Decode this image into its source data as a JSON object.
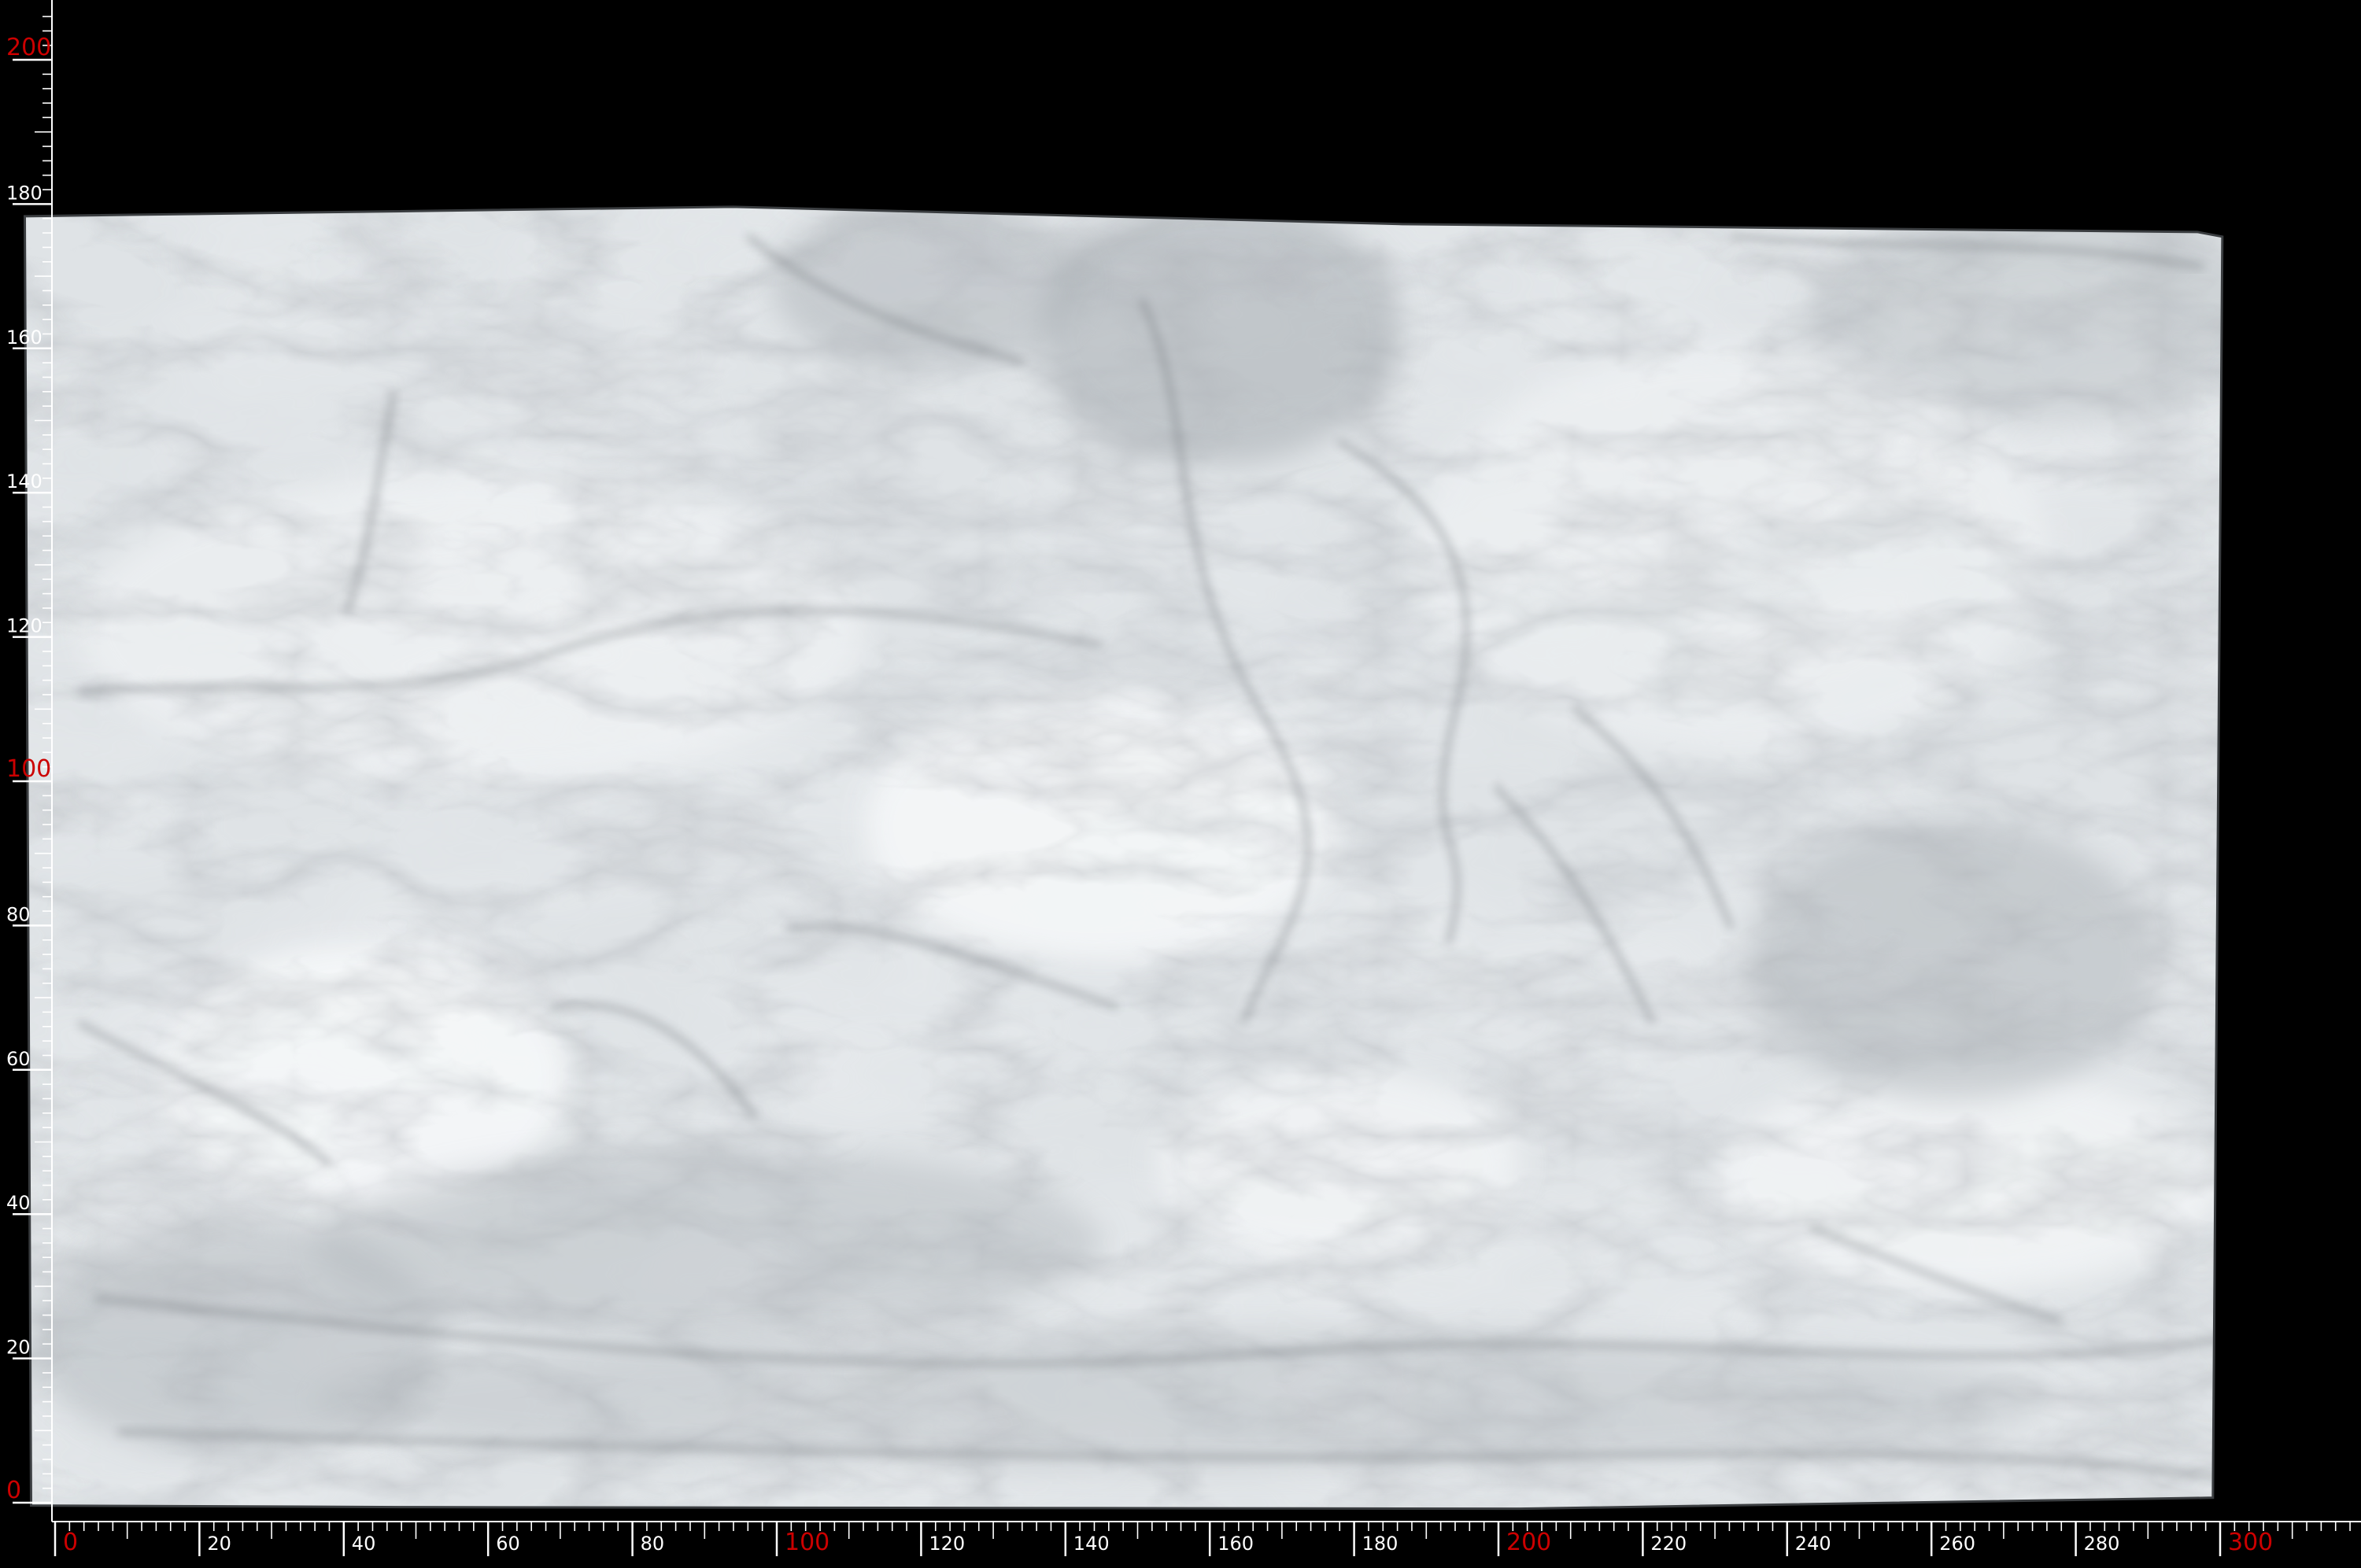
{
  "colors": {
    "background": "#000000",
    "ruler_line": "#ffffff",
    "label_normal": "#ffffff",
    "label_major": "#cc0000",
    "slab_base": "#dfe3e6",
    "slab_vein_dark": "#6f7479",
    "slab_vein_mid": "#a8aeb3",
    "slab_highlight": "#f6f8f9"
  },
  "rulers": {
    "unit_step_minor": 2,
    "unit_step_label": 20,
    "x_axis": {
      "min": 0,
      "max": 320,
      "labels": [
        {
          "value": 0,
          "text": "0",
          "major": true
        },
        {
          "value": 20,
          "text": "20",
          "major": false
        },
        {
          "value": 40,
          "text": "40",
          "major": false
        },
        {
          "value": 60,
          "text": "60",
          "major": false
        },
        {
          "value": 80,
          "text": "80",
          "major": false
        },
        {
          "value": 100,
          "text": "100",
          "major": true
        },
        {
          "value": 120,
          "text": "120",
          "major": false
        },
        {
          "value": 140,
          "text": "140",
          "major": false
        },
        {
          "value": 160,
          "text": "160",
          "major": false
        },
        {
          "value": 180,
          "text": "180",
          "major": false
        },
        {
          "value": 200,
          "text": "200",
          "major": true
        },
        {
          "value": 220,
          "text": "220",
          "major": false
        },
        {
          "value": 240,
          "text": "240",
          "major": false
        },
        {
          "value": 260,
          "text": "260",
          "major": false
        },
        {
          "value": 280,
          "text": "280",
          "major": false
        },
        {
          "value": 300,
          "text": "300",
          "major": true
        }
      ]
    },
    "y_axis": {
      "min": 0,
      "max": 206,
      "labels": [
        {
          "value": 0,
          "text": "0",
          "major": true
        },
        {
          "value": 20,
          "text": "20",
          "major": false
        },
        {
          "value": 40,
          "text": "40",
          "major": false
        },
        {
          "value": 60,
          "text": "60",
          "major": false
        },
        {
          "value": 80,
          "text": "80",
          "major": false
        },
        {
          "value": 100,
          "text": "100",
          "major": true
        },
        {
          "value": 120,
          "text": "120",
          "major": false
        },
        {
          "value": 140,
          "text": "140",
          "major": false
        },
        {
          "value": 160,
          "text": "160",
          "major": false
        },
        {
          "value": 180,
          "text": "180",
          "major": false
        },
        {
          "value": 200,
          "text": "200",
          "major": true
        }
      ]
    }
  },
  "slab": {
    "material": "marble",
    "width_units": 301,
    "height_units": 181
  }
}
